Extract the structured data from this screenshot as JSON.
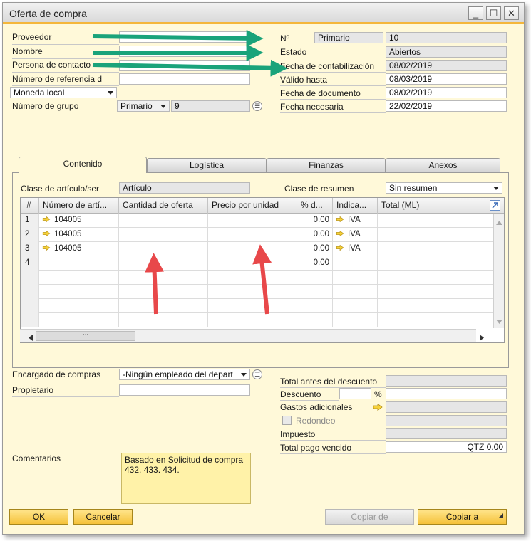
{
  "window": {
    "title": "Oferta de compra"
  },
  "header_left": {
    "proveedor_label": "Proveedor",
    "nombre_label": "Nombre",
    "persona_label": "Persona de contacto",
    "referencia_label": "Número de referencia d",
    "moneda_value": "Moneda local",
    "grupo_label": "Número de grupo",
    "grupo_series": "Primario",
    "grupo_number": "9"
  },
  "header_right": {
    "no_label": "Nº",
    "no_series": "Primario",
    "no_value": "10",
    "estado_label": "Estado",
    "estado_value": "Abiertos",
    "contab_label": "Fecha de contabilización",
    "contab_value": "08/02/2019",
    "valido_label": "Válido hasta",
    "valido_value": "08/03/2019",
    "doc_label": "Fecha de documento",
    "doc_value": "08/02/2019",
    "necesaria_label": "Fecha necesaria",
    "necesaria_value": "22/02/2019"
  },
  "tabs": [
    "Contenido",
    "Logística",
    "Finanzas",
    "Anexos"
  ],
  "content": {
    "clase_label": "Clase de artículo/ser",
    "clase_value": "Artículo",
    "resumen_label": "Clase de resumen",
    "resumen_value": "Sin resumen"
  },
  "grid": {
    "columns": [
      "#",
      "Número de artí...",
      "Cantidad de oferta",
      "Precio por unidad",
      "% d...",
      "Indica...",
      "Total (ML)"
    ],
    "rows": [
      {
        "num": "1",
        "item": "104005",
        "qty": "",
        "price": "",
        "disc": "0.00",
        "tax": "IVA",
        "total": ""
      },
      {
        "num": "2",
        "item": "104005",
        "qty": "",
        "price": "",
        "disc": "0.00",
        "tax": "IVA",
        "total": ""
      },
      {
        "num": "3",
        "item": "104005",
        "qty": "",
        "price": "",
        "disc": "0.00",
        "tax": "IVA",
        "total": ""
      },
      {
        "num": "4",
        "item": "",
        "qty": "",
        "price": "",
        "disc": "0.00",
        "tax": "",
        "total": ""
      }
    ]
  },
  "footer_left": {
    "encargado_label": "Encargado de compras",
    "encargado_value": "-Ningún empleado del depart",
    "propietario_label": "Propietario",
    "comentarios_label": "Comentarios",
    "comentarios_value": "Basado en Solicitud de compra 432. 433. 434."
  },
  "totals": {
    "antes_label": "Total antes del descuento",
    "descuento_label": "Descuento",
    "percent": "%",
    "gastos_label": "Gastos adicionales",
    "redondeo_label": "Redondeo",
    "impuesto_label": "Impuesto",
    "pago_label": "Total pago vencido",
    "pago_value": "QTZ 0.00"
  },
  "buttons": {
    "ok": "OK",
    "cancelar": "Cancelar",
    "copiar_de": "Copiar de",
    "copiar_a": "Copiar a"
  },
  "colors": {
    "window_bg": "#fff9d9",
    "accent": "#f4b63a",
    "annotation_green": "#1aa37a",
    "annotation_red": "#e8484a"
  }
}
